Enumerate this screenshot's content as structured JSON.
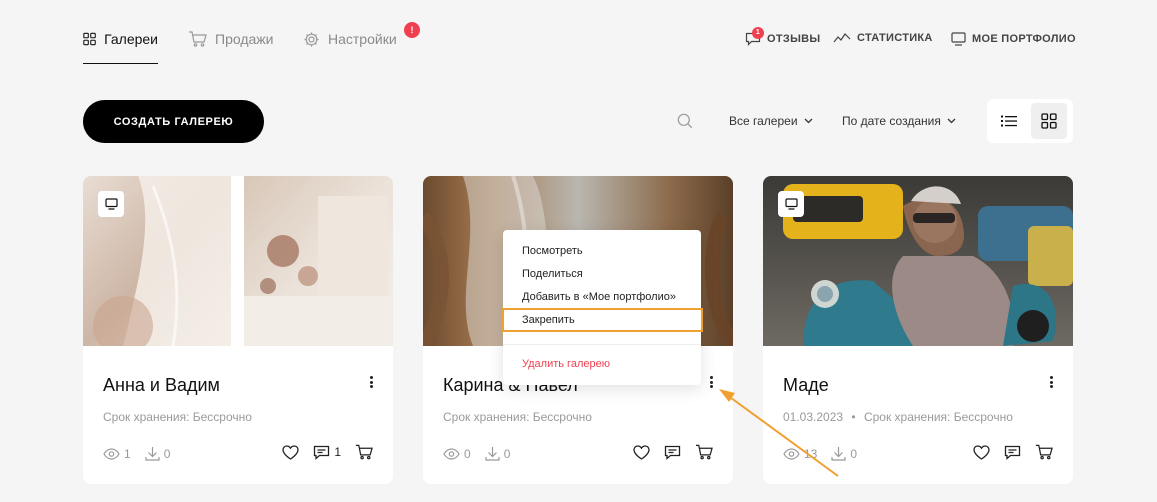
{
  "nav": {
    "tabs": [
      {
        "label": "Галереи",
        "icon": "grid-icon"
      },
      {
        "label": "Продажи",
        "icon": "cart-icon"
      },
      {
        "label": "Настройки",
        "icon": "gear-icon"
      }
    ],
    "settings_badge": "!",
    "right_links": {
      "reviews": "ОТЗЫВЫ",
      "reviews_badge": "1",
      "stats": "СТАТИСТИКА",
      "portfolio": "МОЕ ПОРТФОЛИО"
    }
  },
  "toolbar": {
    "create_label": "СОЗДАТЬ ГАЛЕРЕЮ",
    "filter_label": "Все галереи",
    "sort_label": "По дате создания"
  },
  "cards": [
    {
      "title": "Анна и Вадим",
      "meta": "Срок хранения: Бессрочно",
      "views": "1",
      "downloads": "0",
      "comments": "1"
    },
    {
      "title": "Карина & Павел",
      "meta": "Срок хранения: Бессрочно",
      "views": "0",
      "downloads": "0",
      "comments": ""
    },
    {
      "title": "Маде",
      "date": "01.03.2023",
      "meta": "Срок хранения: Бессрочно",
      "views": "13",
      "downloads": "0",
      "comments": ""
    }
  ],
  "context_menu": {
    "view": "Посмотреть",
    "share": "Поделиться",
    "add_portfolio": "Добавить в «Мое портфолио»",
    "pin": "Закрепить",
    "delete": "Удалить галерею"
  },
  "colors": {
    "accent_red": "#f0404f",
    "highlight_orange": "#f0a030",
    "primary_black": "#000000"
  }
}
